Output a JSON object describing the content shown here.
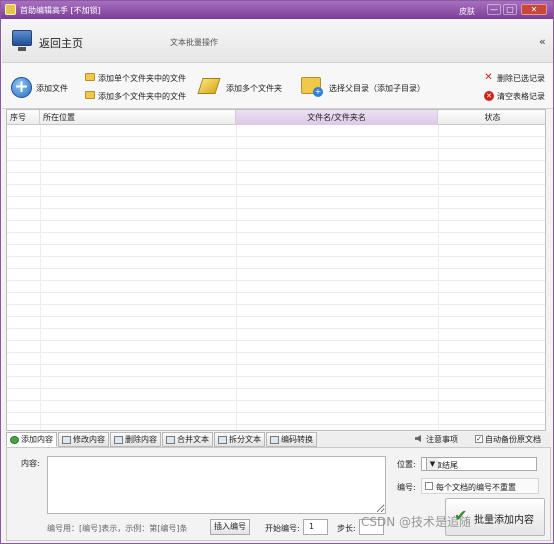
{
  "window": {
    "title": "首助编辑高手 [不加锁]",
    "skin": "皮肤",
    "min_glyph": "—",
    "max_glyph": "□",
    "close_glyph": "✕"
  },
  "nav": {
    "home": "返回主页",
    "subtitle": "文本批量操作",
    "collapse": "«"
  },
  "toolbar": {
    "add_file": "添加文件",
    "add_single_folder": "添加单个文件夹中的文件",
    "add_multi_folder": "添加多个文件夹中的文件",
    "add_multi_folders": "添加多个文件夹",
    "select_parent": "选择父目录（添加子目录）",
    "delete_selected": "删除已选记录",
    "clear_table": "清空表格记录"
  },
  "table": {
    "headers": [
      "序号",
      "所在位置",
      "文件名/文件夹名",
      "状态"
    ],
    "rows": []
  },
  "tabs": [
    {
      "label": "添加内容",
      "active": true
    },
    {
      "label": "修改内容"
    },
    {
      "label": "删除内容"
    },
    {
      "label": "合并文本"
    },
    {
      "label": "拆分文本"
    },
    {
      "label": "编码转换"
    }
  ],
  "options": {
    "notes": "注意事项",
    "auto_backup": "自动备份原文档",
    "auto_backup_checked": true
  },
  "panel": {
    "content_label": "内容:",
    "position_label": "位置:",
    "position_value": "文章结尾",
    "number_label": "编号:",
    "number_option": "每个文档的编号不重置",
    "hint": "编号用：[编号]表示，示例：第[编号]条",
    "insert_button": "插入编号",
    "start_label": "开始编号:",
    "start_value": "1",
    "step_label": "步长:",
    "batch_button": "批量添加内容"
  },
  "watermark": "CSDN @技术是追随"
}
